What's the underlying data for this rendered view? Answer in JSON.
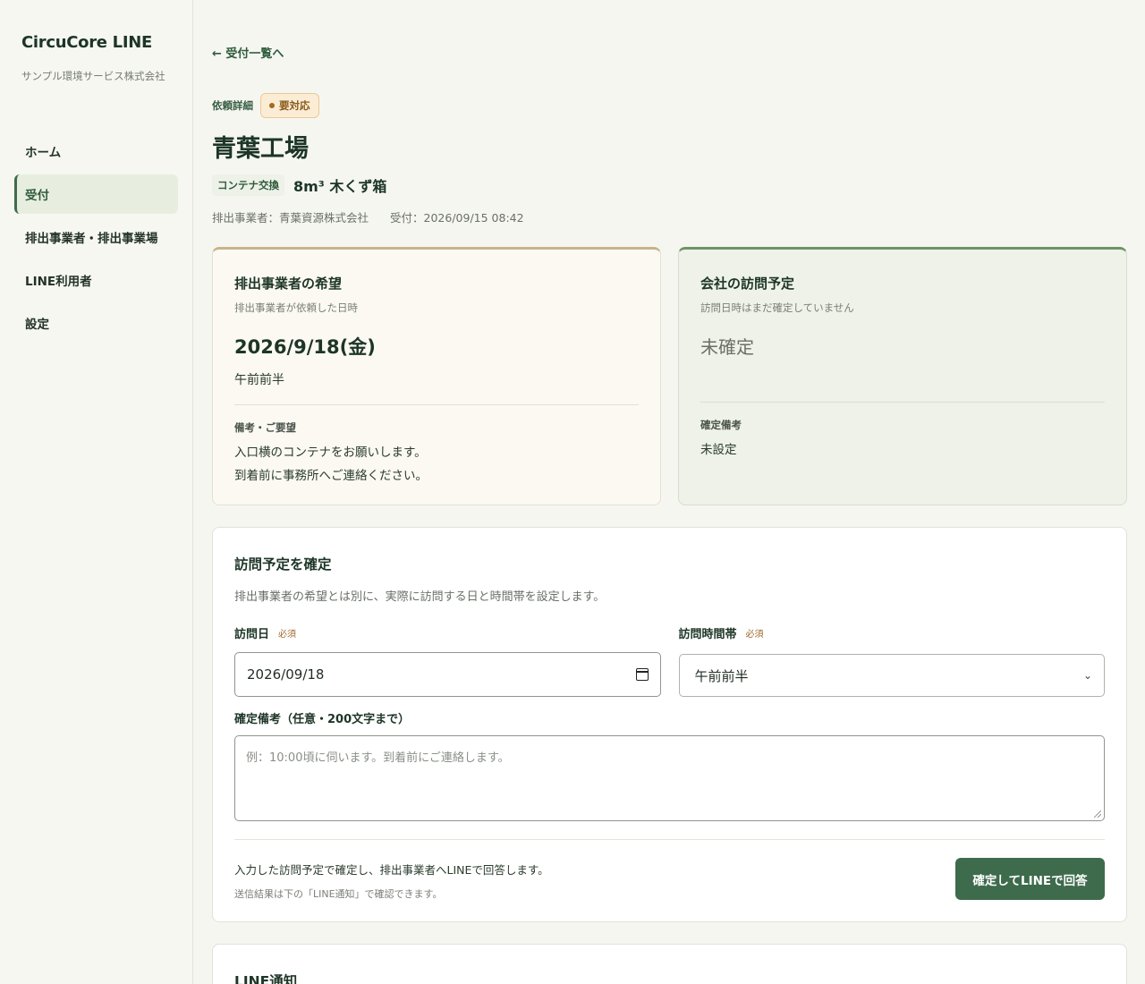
{
  "sidebar": {
    "brand": "CircuCore LINE",
    "org": "サンプル環境サービス株式会社",
    "items": [
      {
        "label": "ホーム"
      },
      {
        "label": "受付"
      },
      {
        "label": "排出事業者・排出事業場"
      },
      {
        "label": "LINE利用者"
      },
      {
        "label": "設定"
      }
    ]
  },
  "header": {
    "back": "← 受付一覧へ",
    "eyebrow": "依頼詳細",
    "badge": "要対応",
    "title": "青葉工場",
    "service_tag": "コンテナ交換",
    "container": "8m³ 木くず箱",
    "emitter": "排出事業者：青葉資源株式会社",
    "received": "受付：2026/09/15 08:42"
  },
  "wish": {
    "title": "排出事業者の希望",
    "sub": "排出事業者が依頼した日時",
    "date": "2026/9/18(金)",
    "slot": "午前前半",
    "note_label": "備考・ご要望",
    "note_line1": "入口横のコンテナをお願いします。",
    "note_line2": "到着前に事務所へご連絡ください。"
  },
  "plan": {
    "title": "会社の訪問予定",
    "sub": "訪問日時はまだ確定していません",
    "status": "未確定",
    "note_label": "確定備考",
    "note_value": "未設定"
  },
  "form": {
    "title": "訪問予定を確定",
    "desc": "排出事業者の希望とは別に、実際に訪問する日と時間帯を設定します。",
    "date_label": "訪問日",
    "date_value": "2026/09/18",
    "time_label": "訪問時間帯",
    "time_value": "午前前半",
    "required": "必須",
    "memo_label": "確定備考（任意・200文字まで）",
    "memo_placeholder": "例：10:00頃に伺います。到着前にご連絡します。",
    "submit_text": "入力した訪問予定で確定し、排出事業者へLINEで回答します。",
    "submit_sub": "送信結果は下の「LINE通知」で確認できます。",
    "submit_button": "確定してLINEで回答"
  },
  "line_panel": {
    "title": "LINE通知"
  },
  "colors": {
    "accent": "#3d6b4b",
    "badge_bg": "#fbecd5",
    "wish_border": "#c7b488",
    "plan_border": "#6f9466"
  }
}
